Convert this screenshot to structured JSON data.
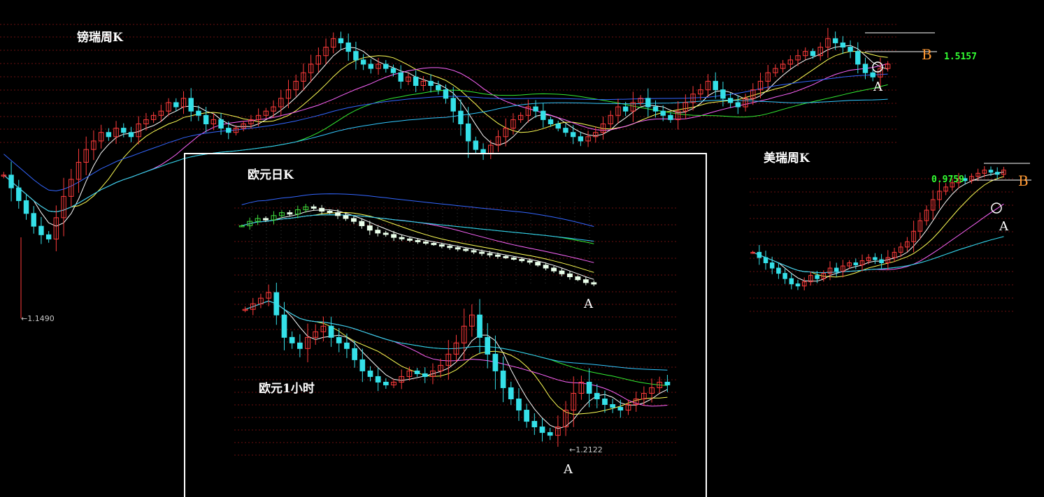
{
  "colors": {
    "background": "#000000",
    "grid": "#6b0f0f",
    "bull": "#ff3b3b",
    "bear": "#35e0e8",
    "bear_daily": "#eaffea",
    "bull_daily": "#3ddc3d",
    "ma5": "#ffffff",
    "ma10": "#ffff55",
    "ma20": "#ff66ff",
    "ma40": "#33ee33",
    "ma60": "#33c8ff",
    "ma120": "#3366ff",
    "level": "#33ff33",
    "marker_b": "#ff9933",
    "frame": "#ffffff"
  },
  "chart_data": [
    {
      "id": "gbpchf",
      "type": "candlestick",
      "title": "镑瑞周K",
      "low_label": "1.1490",
      "level_label": "1.5157",
      "marker_a": "A",
      "marker_b": "B",
      "closes": [
        1.3,
        1.27,
        1.24,
        1.21,
        1.18,
        1.16,
        1.15,
        1.2,
        1.25,
        1.29,
        1.33,
        1.36,
        1.38,
        1.4,
        1.39,
        1.41,
        1.4,
        1.39,
        1.42,
        1.43,
        1.44,
        1.45,
        1.47,
        1.46,
        1.48,
        1.45,
        1.44,
        1.42,
        1.43,
        1.41,
        1.4,
        1.41,
        1.42,
        1.43,
        1.44,
        1.45,
        1.46,
        1.48,
        1.5,
        1.52,
        1.54,
        1.56,
        1.58,
        1.6,
        1.62,
        1.61,
        1.59,
        1.57,
        1.56,
        1.55,
        1.56,
        1.55,
        1.54,
        1.52,
        1.53,
        1.51,
        1.52,
        1.51,
        1.5,
        1.48,
        1.45,
        1.42,
        1.38,
        1.36,
        1.35,
        1.37,
        1.39,
        1.41,
        1.43,
        1.44,
        1.46,
        1.45,
        1.43,
        1.42,
        1.41,
        1.4,
        1.39,
        1.38,
        1.39,
        1.4,
        1.42,
        1.44,
        1.46,
        1.45,
        1.47,
        1.48,
        1.46,
        1.45,
        1.44,
        1.43,
        1.45,
        1.47,
        1.49,
        1.5,
        1.52,
        1.5,
        1.48,
        1.47,
        1.46,
        1.48,
        1.5,
        1.52,
        1.54,
        1.55,
        1.56,
        1.57,
        1.58,
        1.59,
        1.58,
        1.6,
        1.62,
        1.61,
        1.6,
        1.59,
        1.56,
        1.54,
        1.53,
        1.55,
        1.56
      ]
    },
    {
      "id": "usdchf",
      "type": "candlestick",
      "title": "美瑞周K",
      "level_label": "0.9759",
      "marker_a": "A",
      "marker_b": "B",
      "closes": [
        0.9,
        0.895,
        0.89,
        0.885,
        0.88,
        0.875,
        0.87,
        0.868,
        0.872,
        0.878,
        0.875,
        0.88,
        0.885,
        0.882,
        0.887,
        0.89,
        0.888,
        0.892,
        0.895,
        0.893,
        0.89,
        0.895,
        0.9,
        0.905,
        0.91,
        0.92,
        0.93,
        0.94,
        0.95,
        0.958,
        0.962,
        0.966,
        0.97,
        0.968,
        0.972,
        0.975,
        0.978,
        0.976,
        0.974,
        0.978
      ]
    },
    {
      "id": "eurusd-daily",
      "type": "candlestick",
      "title": "欧元日K",
      "marker_a": "A",
      "closes": [
        1.305,
        1.308,
        1.31,
        1.309,
        1.312,
        1.314,
        1.313,
        1.316,
        1.318,
        1.317,
        1.315,
        1.314,
        1.312,
        1.31,
        1.308,
        1.305,
        1.302,
        1.3,
        1.299,
        1.297,
        1.296,
        1.295,
        1.294,
        1.293,
        1.292,
        1.291,
        1.29,
        1.289,
        1.288,
        1.287,
        1.286,
        1.285,
        1.284,
        1.283,
        1.282,
        1.281,
        1.28,
        1.278,
        1.276,
        1.274,
        1.272,
        1.27,
        1.268,
        1.266,
        1.265
      ]
    },
    {
      "id": "eurusd-1h",
      "type": "candlestick",
      "title": "欧元1小时",
      "low_label": "1.2122",
      "marker_a": "A",
      "closes": [
        1.235,
        1.236,
        1.237,
        1.238,
        1.234,
        1.23,
        1.229,
        1.228,
        1.23,
        1.231,
        1.232,
        1.23,
        1.229,
        1.228,
        1.226,
        1.224,
        1.223,
        1.222,
        1.2215,
        1.222,
        1.223,
        1.224,
        1.2235,
        1.223,
        1.224,
        1.225,
        1.227,
        1.229,
        1.232,
        1.234,
        1.23,
        1.227,
        1.224,
        1.221,
        1.219,
        1.217,
        1.215,
        1.214,
        1.213,
        1.2125,
        1.214,
        1.217,
        1.22,
        1.222,
        1.22,
        1.219,
        1.218,
        1.2175,
        1.217,
        1.218,
        1.219,
        1.22,
        1.221,
        1.222,
        1.2215
      ]
    }
  ]
}
